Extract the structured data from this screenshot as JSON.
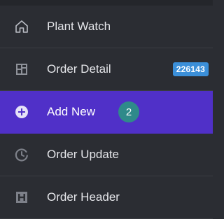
{
  "menu": {
    "items": [
      {
        "label": "Plant Watch",
        "icon": "home-icon"
      },
      {
        "label": "Order Detail",
        "icon": "grid-detail-icon",
        "badge": "226143"
      },
      {
        "label": "Add New",
        "icon": "plus-circle-icon",
        "count": "2",
        "active": true
      },
      {
        "label": "Order Update",
        "icon": "history-icon"
      },
      {
        "label": "Order Header",
        "icon": "header-icon"
      }
    ]
  },
  "colors": {
    "background": "#2b2d33",
    "active": "#5030c8",
    "id_badge": "#3b8fd9",
    "count_badge": "#2f8a8a"
  }
}
